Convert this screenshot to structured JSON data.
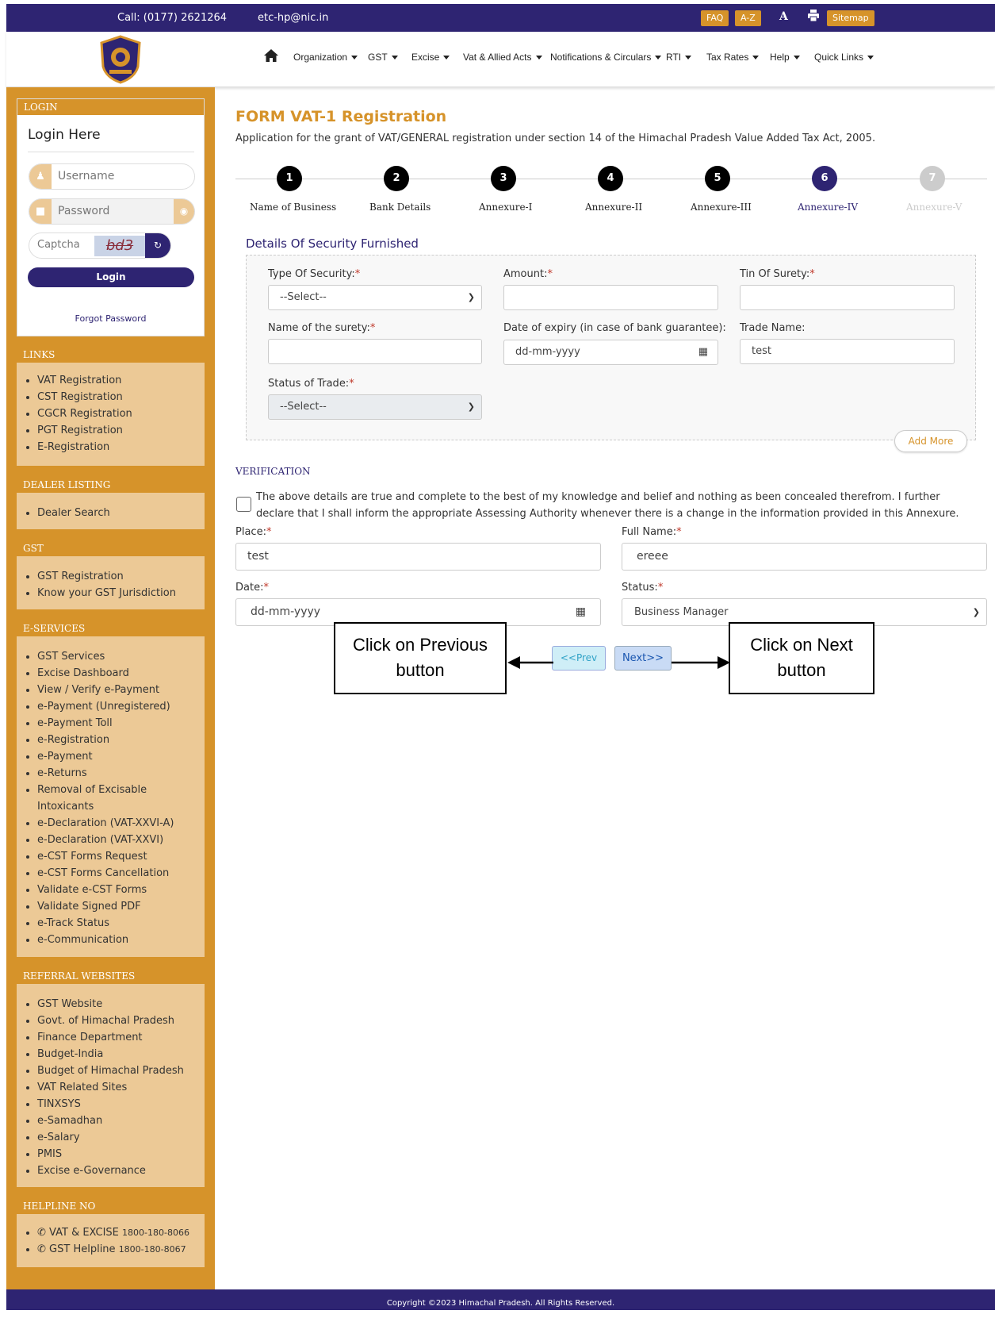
{
  "topbar": {
    "call": "Call: (0177) 2621264",
    "email": "etc-hp@nic.in",
    "faq": "FAQ",
    "az": "A-Z",
    "font_icon": "A",
    "print_icon": "print-icon",
    "sitemap": "Sitemap"
  },
  "nav": {
    "home_icon": "home-icon",
    "items": [
      "Organization",
      "GST",
      "Excise",
      "Vat & Allied Acts",
      "Notifications & Circulars",
      "RTI",
      "Tax Rates",
      "Help",
      "Quick Links"
    ]
  },
  "login": {
    "header": "LOGIN",
    "title": "Login Here",
    "username_placeholder": "Username",
    "password_placeholder": "Password",
    "captcha_placeholder": "Captcha",
    "captcha_text": "bd3",
    "login_button": "Login",
    "forgot": "Forgot Password"
  },
  "panels": {
    "links": {
      "title": "LINKS",
      "items": [
        "VAT Registration",
        "CST Registration",
        "CGCR Registration",
        "PGT Registration",
        "E-Registration"
      ]
    },
    "dealer": {
      "title": "DEALER LISTING",
      "items": [
        "Dealer Search"
      ]
    },
    "gst": {
      "title": "GST",
      "items": [
        "GST Registration",
        "Know your GST Jurisdiction"
      ]
    },
    "eservices": {
      "title": "E-SERVICES",
      "items": [
        "GST Services",
        "Excise Dashboard",
        "View / Verify e-Payment",
        "e-Payment (Unregistered)",
        "e-Payment Toll",
        "e-Registration",
        "e-Payment",
        "e-Returns",
        "Removal of Excisable Intoxicants",
        "e-Declaration (VAT-XXVI-A)",
        "e-Declaration (VAT-XXVI)",
        "e-CST Forms Request",
        "e-CST Forms Cancellation",
        "Validate e-CST Forms",
        "Validate Signed PDF",
        "e-Track Status",
        "e-Communication"
      ]
    },
    "referral": {
      "title": "REFERRAL WEBSITES",
      "items": [
        "GST Website",
        "Govt. of Himachal Pradesh",
        "Finance Department",
        "Budget-India",
        "Budget of Himachal Pradesh",
        "VAT Related Sites",
        "TINXSYS",
        "e-Samadhan",
        "e-Salary",
        "PMIS",
        "Excise e-Governance"
      ]
    },
    "helpline": {
      "title": "HELPLINE NO",
      "items": [
        {
          "label": "VAT & EXCISE",
          "number": "1800-180-8066"
        },
        {
          "label": "GST Helpline",
          "number": "1800-180-8067"
        }
      ]
    }
  },
  "form": {
    "title": "FORM VAT-1 Registration",
    "description": "Application for the grant of VAT/GENERAL registration under section 14 of the Himachal Pradesh Value Added Tax Act, 2005.",
    "steps": [
      {
        "num": "1",
        "label": "Name of Business"
      },
      {
        "num": "2",
        "label": "Bank Details"
      },
      {
        "num": "3",
        "label": "Annexure-I"
      },
      {
        "num": "4",
        "label": "Annexure-II"
      },
      {
        "num": "5",
        "label": "Annexure-III"
      },
      {
        "num": "6",
        "label": "Annexure-IV"
      },
      {
        "num": "7",
        "label": "Annexure-V"
      }
    ],
    "section_title": "Details Of Security Furnished",
    "fields": {
      "type_of_security": {
        "label": "Type Of Security:",
        "value": "--Select--"
      },
      "amount": {
        "label": "Amount:",
        "value": ""
      },
      "tin_of_surety": {
        "label": "Tin Of Surety:",
        "value": ""
      },
      "name_of_surety": {
        "label": "Name of the surety:",
        "value": ""
      },
      "date_of_expiry": {
        "label": "Date of expiry (in case of bank guarantee):",
        "value": "dd-mm-yyyy"
      },
      "trade_name": {
        "label": "Trade Name:",
        "value": "test"
      },
      "status_of_trade": {
        "label": "Status of Trade:",
        "value": "--Select--"
      }
    },
    "add_more": "Add More",
    "verification_title": "VERIFICATION",
    "declaration": "The above details are true and complete to the best of my knowledge and belief and nothing as been concealed therefrom. I further declare that I shall inform the appropriate Assessing Authority whenever there is a change in the information provided in this Annexure.",
    "place": {
      "label": "Place:",
      "value": "test"
    },
    "full_name": {
      "label": "Full Name:",
      "value": "ereee"
    },
    "date": {
      "label": "Date:",
      "value": "dd-mm-yyyy"
    },
    "status": {
      "label": "Status:",
      "value": "Business Manager"
    },
    "prev_button": "<<Prev",
    "next_button": "Next>>"
  },
  "annotations": {
    "prev_callout": "Click on Previous button",
    "next_callout": "Click on Next button"
  },
  "footer": "Copyright ©2023 Himachal Pradesh. All Rights Reserved.",
  "colors": {
    "primary": "#2e2472",
    "accent": "#d6932a",
    "panel_bg": "#ecc996"
  }
}
